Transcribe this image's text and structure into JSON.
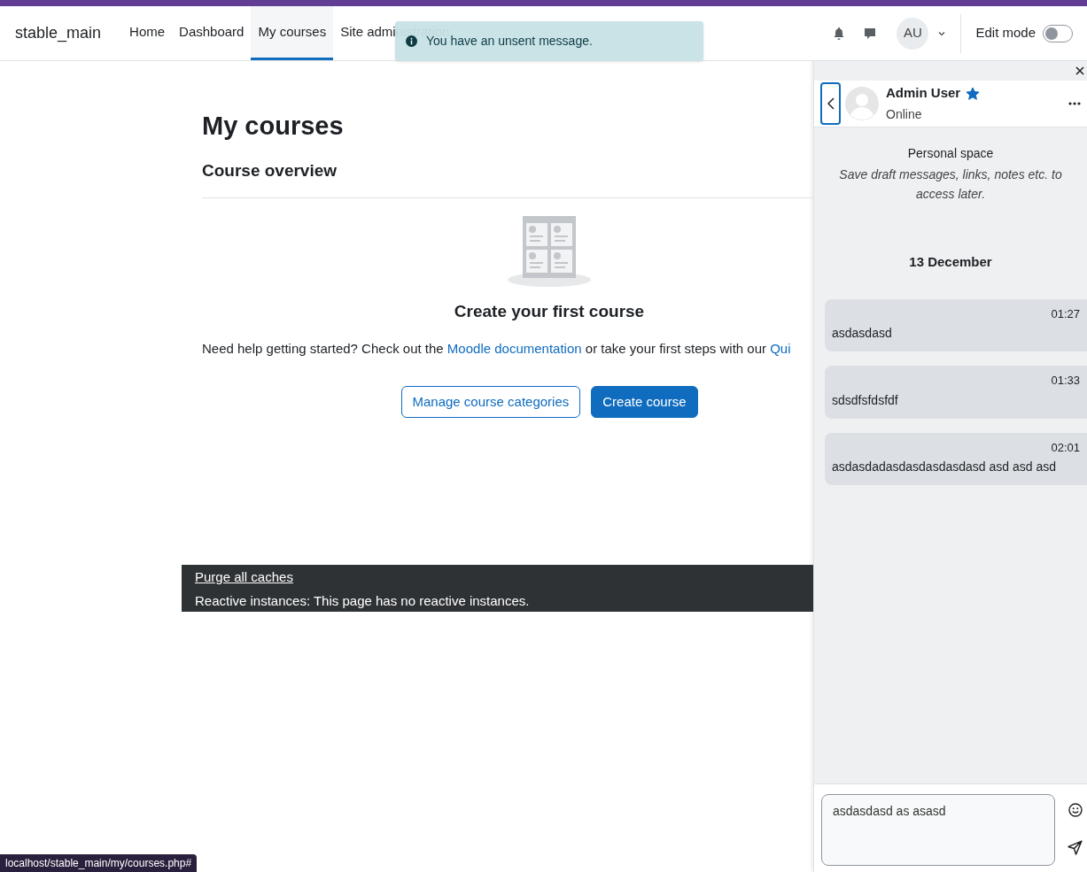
{
  "site_name": "stable_main",
  "nav": [
    {
      "label": "Home",
      "selected": false
    },
    {
      "label": "Dashboard",
      "selected": false
    },
    {
      "label": "My courses",
      "selected": true
    },
    {
      "label": "Site administration",
      "selected": false
    }
  ],
  "user_initials": "AU",
  "edit_mode": {
    "label": "Edit mode",
    "on": false
  },
  "toast": {
    "text": "You have an unsent message."
  },
  "page": {
    "title": "My courses",
    "subtitle": "Course overview",
    "empty_title": "Create your first course",
    "help": [
      {
        "kind": "text",
        "text": "Need help getting started? Check out the "
      },
      {
        "kind": "link",
        "text": "Moodle documentation"
      },
      {
        "kind": "text",
        "text": " or take your first steps with our "
      },
      {
        "kind": "link",
        "text": "Qui"
      }
    ],
    "buttons": [
      {
        "label": "Manage course categories",
        "kind": "outline"
      },
      {
        "label": "Create course",
        "kind": "primary"
      }
    ]
  },
  "debug": {
    "link": "Purge all caches",
    "text": "Reactive instances: This page has no reactive instances."
  },
  "drawer": {
    "contact": {
      "name": "Admin User",
      "starred": true,
      "status": "Online"
    },
    "intro_title": "Personal space",
    "intro_text": "Save draft messages, links, notes etc. to access later.",
    "date": "13 December",
    "messages": [
      {
        "time": "01:27",
        "text": "asdasdasd"
      },
      {
        "time": "01:33",
        "text": "sdsdfsfdsfdf"
      },
      {
        "time": "02:01",
        "text": "asdasdadasdasdasdasdasd asd asd asd"
      }
    ],
    "draft": "asdasdasd as asasd"
  },
  "status_url": "localhost/stable_main/my/courses.php#"
}
